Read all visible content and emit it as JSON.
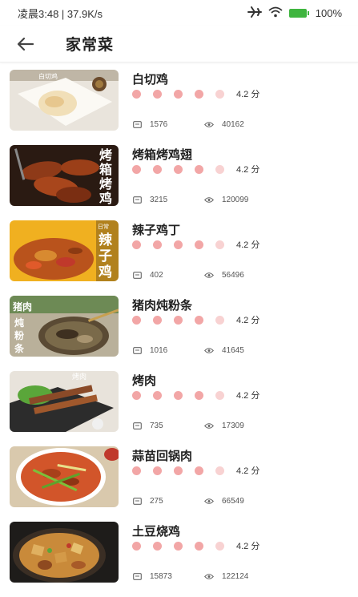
{
  "status_bar": {
    "time_speed": "凌晨3:48 | 37.9K/s",
    "battery": "100%",
    "icons": [
      "airplane-icon",
      "wifi-icon",
      "battery-icon"
    ]
  },
  "header": {
    "back_icon": "back-arrow-icon",
    "title": "家常菜"
  },
  "items": [
    {
      "name": "白切鸡",
      "score": "4.2 分",
      "comments": "1576",
      "views": "40162"
    },
    {
      "name": "烤箱烤鸡翅",
      "score": "4.2 分",
      "comments": "3215",
      "views": "120099"
    },
    {
      "name": "辣子鸡丁",
      "score": "4.2 分",
      "comments": "402",
      "views": "56496"
    },
    {
      "name": "猪肉炖粉条",
      "score": "4.2 分",
      "comments": "1016",
      "views": "41645"
    },
    {
      "name": "烤肉",
      "score": "4.2 分",
      "comments": "735",
      "views": "17309"
    },
    {
      "name": "蒜苗回锅肉",
      "score": "4.2 分",
      "comments": "275",
      "views": "66549"
    },
    {
      "name": "土豆烧鸡",
      "score": "4.2 分",
      "comments": "15873",
      "views": "122124"
    }
  ],
  "thumb_text": {
    "t0": "白切鸡",
    "t1": "烤箱烤鸡",
    "t2": "辣子鸡丁",
    "t2_tag": "日常",
    "t3": "猪肉炖粉条",
    "t4": "烤肉"
  },
  "rating_stars": 5,
  "colors": {
    "dot": "#f2a6a6",
    "dot_light": "#f8d2d2",
    "battery": "#3fb53f"
  }
}
